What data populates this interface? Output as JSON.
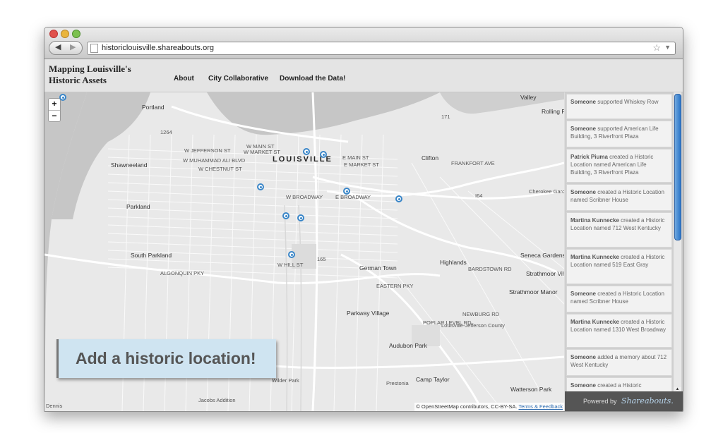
{
  "browser": {
    "url": "historiclouisville.shareabouts.org",
    "back_icon": "back-arrow-icon",
    "forward_icon": "forward-arrow-icon"
  },
  "site": {
    "title_line1": "Mapping Louisville's",
    "title_line2": "Historic Assets",
    "nav": [
      "About",
      "City Collaborative",
      "Download the Data!"
    ]
  },
  "map": {
    "city_label": "LOUISVILLE",
    "zoom_in": "+",
    "zoom_out": "−",
    "add_button": "Add a historic location!",
    "attribution_text": "© OpenStreetMap contributors, CC-BY-SA.",
    "attribution_link": "Terms & Feedback",
    "labels": {
      "portland": "Portland",
      "shawnee": "Shawneeland",
      "parkland": "Parkland",
      "south_parkland": "South Parkland",
      "german_town": "German Town",
      "highlands": "Highlands",
      "parkway_village": "Parkway Village",
      "audubon_park": "Audubon Park",
      "camp_taylor": "Camp Taylor",
      "seneca_gardens": "Seneca Gardens",
      "strathmoor_village": "Strathmoor Village",
      "strathmoor_manor": "Strathmoor Manor",
      "watterson_park": "Watterson Park",
      "cherokee_garden": "Cherokee Garden",
      "clifton": "Clifton",
      "rolling": "Rolling F",
      "valley": "Valley",
      "wilder_park": "Wilder Park",
      "jacobs": "Jacobs Addition",
      "prestonia": "Prestonia",
      "dennis": "Dennis",
      "jefferson_county": "Louisville-Jefferson County",
      "broadway": "W BROADWAY",
      "e_broadway": "E BROADWAY",
      "w_main": "W MAIN ST",
      "w_market": "W MARKET ST",
      "w_jefferson": "W JEFFERSON ST",
      "w_muhammad": "W MUHAMMAD ALI BLVD",
      "w_chestnut": "W CHESTNUT ST",
      "e_main": "E MAIN ST",
      "e_market": "E MARKET ST",
      "frankfort": "FRANKFORT AVE",
      "algonquin": "ALGONQUIN PKY",
      "eastern": "EASTERN PKY",
      "bardstown": "BARDSTOWN RD",
      "poplar": "POPLAR LEVEL RD",
      "newburg": "NEWBURG RD",
      "w_hill": "W HILL ST",
      "shields": "165",
      "i264": "1264",
      "i64": "I64",
      "i71": "171"
    }
  },
  "activity": [
    {
      "actor": "Someone",
      "text": " supported Whiskey Row"
    },
    {
      "actor": "Someone",
      "text": " supported American Life Building, 3 Riverfront Plaza"
    },
    {
      "actor": "Patrick Piuma",
      "text": " created a Historic Location named American Life Building, 3 Riverfront Plaza"
    },
    {
      "actor": "Someone",
      "text": " created a Historic Location named Scribner House"
    },
    {
      "actor": "Martina Kunnecke",
      "text": " created a Historic Location named 712 West Kentucky"
    },
    {
      "actor": "Martina Kunnecke",
      "text": " created a Historic Location named 519 East Gray"
    },
    {
      "actor": "Someone",
      "text": " created a Historic Location named Scribner House"
    },
    {
      "actor": "Martina Kunnecke",
      "text": " created a Historic Location named 1310 West Broadway"
    },
    {
      "actor": "Someone",
      "text": " added a memory about 712 West Kentucky"
    },
    {
      "actor": "Someone",
      "text": " created a Historic"
    }
  ],
  "footer": {
    "powered_by": "Powered by",
    "brand": "Shareabouts."
  },
  "colors": {
    "marker": "#3a86c8",
    "river": "#bfbfbf",
    "add_button_bg": "#cfe4f1"
  }
}
